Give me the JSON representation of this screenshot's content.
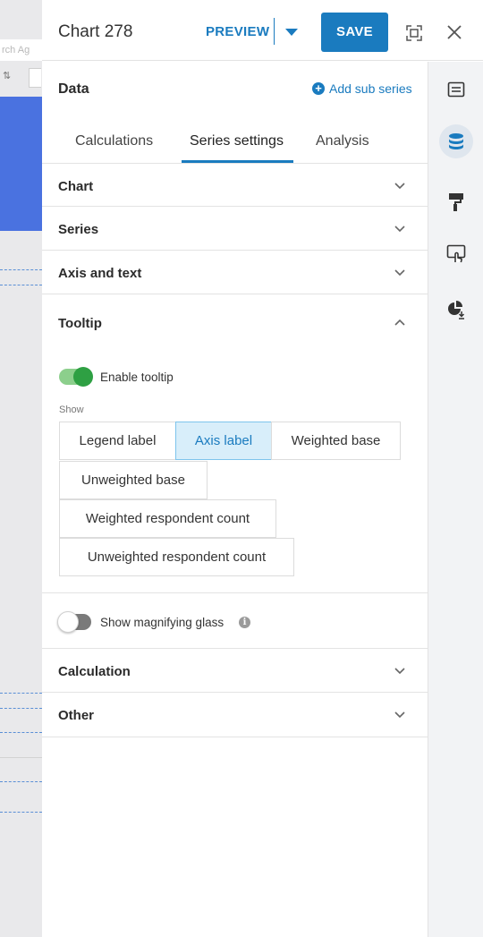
{
  "background": {
    "search_fragment": "rch Ag"
  },
  "header": {
    "chart_title": "Chart 278",
    "preview_label": "PREVIEW",
    "save_label": "SAVE",
    "icons": [
      "expand-icon",
      "close-icon",
      "caret-down-icon"
    ]
  },
  "data_panel": {
    "title": "Data",
    "add_sub_series_label": "Add sub series"
  },
  "tabs": [
    {
      "label": "Calculations",
      "active": false
    },
    {
      "label": "Series settings",
      "active": true
    },
    {
      "label": "Analysis",
      "active": false
    }
  ],
  "sections": {
    "chart": {
      "title": "Chart",
      "expanded": false
    },
    "series": {
      "title": "Series",
      "expanded": false
    },
    "axis_text": {
      "title": "Axis and text",
      "expanded": false
    },
    "tooltip": {
      "title": "Tooltip",
      "expanded": true
    },
    "calculation": {
      "title": "Calculation",
      "expanded": false
    },
    "other": {
      "title": "Other",
      "expanded": false
    }
  },
  "tooltip": {
    "enable_label": "Enable tooltip",
    "enable_on": true,
    "show_label": "Show",
    "options": [
      {
        "label": "Legend label",
        "selected": false
      },
      {
        "label": "Axis label",
        "selected": true
      },
      {
        "label": "Weighted base",
        "selected": false
      },
      {
        "label": "Unweighted base",
        "selected": false
      },
      {
        "label": "Weighted respondent count",
        "selected": false
      },
      {
        "label": "Unweighted respondent count",
        "selected": false
      }
    ],
    "magnifier_label": "Show magnifying glass",
    "magnifier_on": false
  },
  "rail": {
    "items": [
      {
        "icon": "text-box-icon",
        "active": false
      },
      {
        "icon": "database-icon",
        "active": true
      },
      {
        "icon": "paint-roller-icon",
        "active": false
      },
      {
        "icon": "touch-pointer-icon",
        "active": false
      },
      {
        "icon": "pie-chart-download-icon",
        "active": false
      }
    ]
  },
  "colors": {
    "accent": "#1a7bbf",
    "toggle_on": "#2ea043",
    "selected_chip_bg": "#d8eefa"
  }
}
